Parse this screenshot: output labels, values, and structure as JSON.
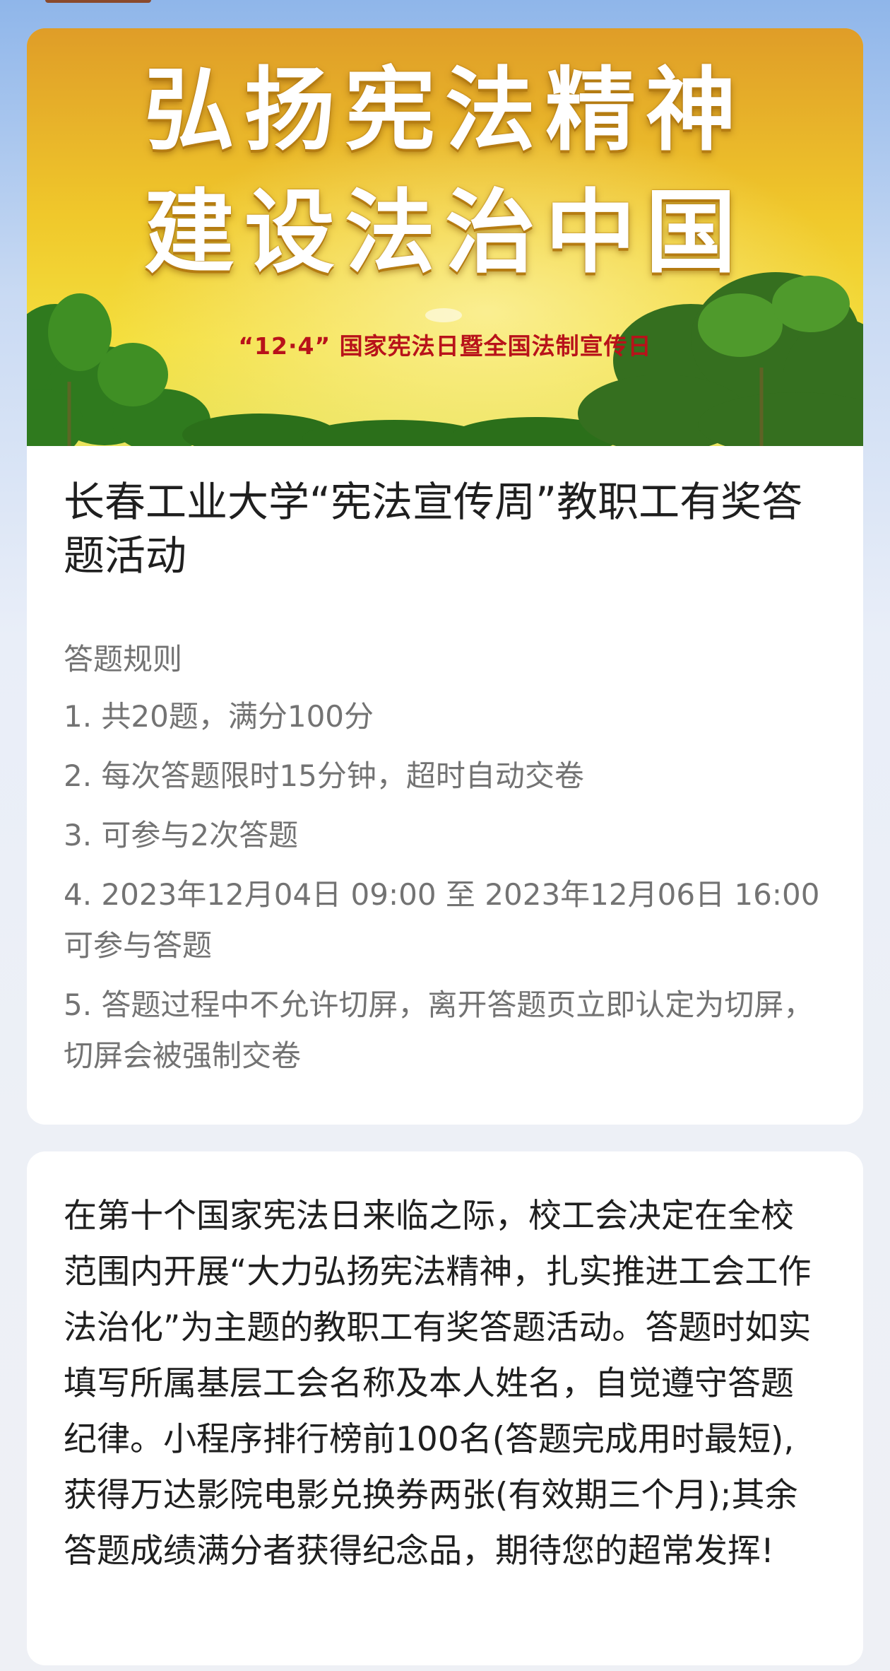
{
  "banner": {
    "line1": "弘扬宪法精神",
    "line2": "建设法治中国",
    "subtitle": "“12·4” 国家宪法日暨全国法制宣传日"
  },
  "activity": {
    "title": "长春工业大学“宪法宣传周”教职工有奖答题活动"
  },
  "rules": {
    "heading": "答题规则",
    "items": [
      "1. 共20题，满分100分",
      "2. 每次答题限时15分钟，超时自动交卷",
      "3. 可参与2次答题",
      "4. 2023年12月04日 09:00 至 2023年12月06日 16:00 可参与答题",
      "5. 答题过程中不允许切屏，离开答题页立即认定为切屏，切屏会被强制交卷"
    ]
  },
  "intro": {
    "text": "在第十个国家宪法日来临之际，校工会决定在全校范围内开展“大力弘扬宪法精神，扎实推进工会工作法治化”为主题的教职工有奖答题活动。答题时如实填写所属基层工会名称及本人姓名，自觉遵守答题纪律。小程序排行榜前100名(答题完成用时最短),获得万达影院电影兑换券两张(有效期三个月);其余答题成绩满分者获得纪念品，期待您的超常发挥!"
  },
  "colors": {
    "page_background": "#dfe7f5",
    "card_background": "#ffffff",
    "title_text": "#1f1f1f",
    "rules_text": "#737373",
    "banner_yellow": "#f0cd2e",
    "banner_subtitle_red": "#b8121a"
  }
}
